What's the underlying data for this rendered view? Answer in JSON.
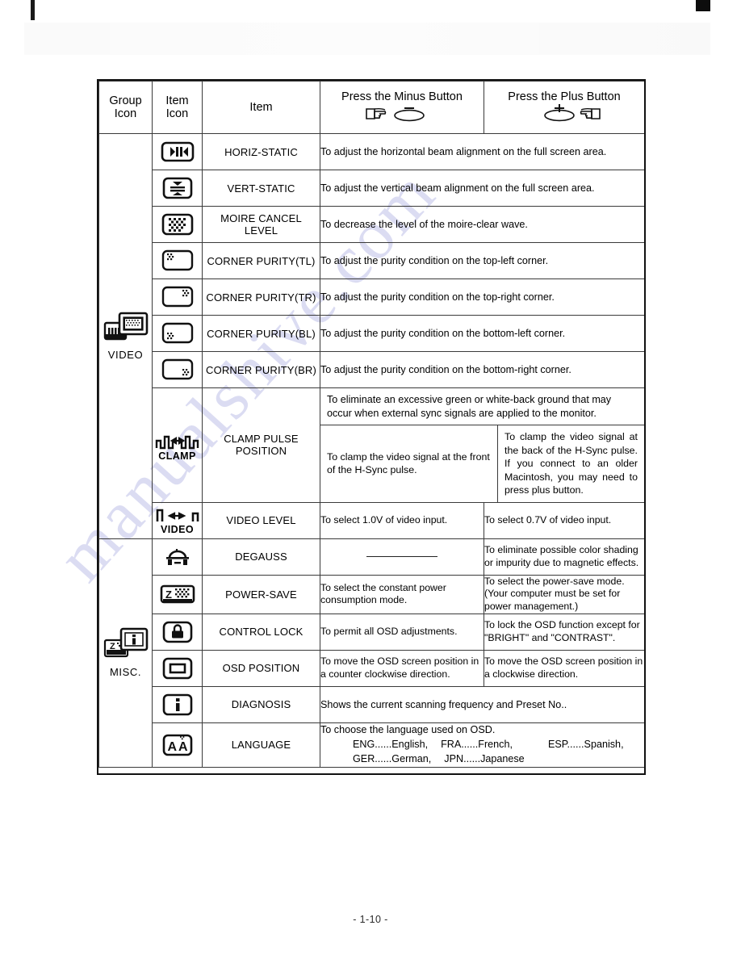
{
  "page": {
    "footer_label": "- 1-10 -",
    "watermark_text": "manualshive.com"
  },
  "table": {
    "headers": {
      "group_icon": "Group\nIcon",
      "group_icon_line1": "Group",
      "group_icon_line2": "Icon",
      "item_icon_line1": "Item",
      "item_icon_line2": "Icon",
      "item": "Item",
      "minus": "Press the Minus Button",
      "plus": "Press the Plus Button",
      "minus_icon": "hand-pointing-right-minus-button-icon",
      "plus_icon": "hand-pointing-left-plus-button-icon"
    },
    "groups": [
      {
        "label": "VIDEO",
        "icon": "video-monitor-group-icon",
        "rows": [
          {
            "icon": "horiz-static-icon",
            "item": "HORIZ-STATIC",
            "merged": true,
            "desc": "To adjust the horizontal beam alignment on the full screen area."
          },
          {
            "icon": "vert-static-icon",
            "item": "VERT-STATIC",
            "merged": true,
            "desc": "To adjust the vertical beam alignment on the full screen area."
          },
          {
            "icon": "moire-cancel-icon",
            "item": "MOIRE CANCEL LEVEL",
            "merged": true,
            "desc": "To decrease the level of the moire-clear wave."
          },
          {
            "icon": "corner-purity-tl-icon",
            "item": "CORNER PURITY(TL)",
            "merged": true,
            "desc": "To adjust the purity condition on the top-left corner."
          },
          {
            "icon": "corner-purity-tr-icon",
            "item": "CORNER PURITY(TR)",
            "merged": true,
            "desc": "To adjust the purity condition on the top-right corner."
          },
          {
            "icon": "corner-purity-bl-icon",
            "item": "CORNER PURITY(BL)",
            "merged": true,
            "desc": "To adjust the purity condition on the bottom-left corner."
          },
          {
            "icon": "corner-purity-br-icon",
            "item": "CORNER PURITY(BR)",
            "merged": true,
            "desc": "To adjust the purity condition on the bottom-right corner."
          },
          {
            "icon": "clamp-pulse-icon",
            "icon_label": "CLAMP",
            "item": "CLAMP PULSE POSITION",
            "merged": false,
            "note": "To eliminate an excessive green or white-back ground that may occur when external sync signals are applied to the monitor.",
            "minus": "To clamp the video signal at the front of the H-Sync pulse.",
            "plus": "To clamp the video signal at the back of the H-Sync pulse.  If you connect to an older Macintosh, you may need to press plus button."
          },
          {
            "icon": "video-level-icon",
            "icon_label": "VIDEO",
            "item": "VIDEO LEVEL",
            "merged": false,
            "minus": "To select 1.0V of video input.",
            "plus": "To select 0.7V of video input."
          }
        ]
      },
      {
        "label": "MISC.",
        "icon": "misc-group-icon",
        "rows": [
          {
            "icon": "degauss-icon",
            "item": "DEGAUSS",
            "merged": false,
            "minus": "",
            "minus_is_dash": true,
            "plus": "To eliminate possible color shading or impurity due to magnetic effects."
          },
          {
            "icon": "power-save-icon",
            "item": "POWER-SAVE",
            "merged": false,
            "minus": "To select the constant power consumption mode.",
            "plus": "To select the power-save mode. (Your computer must be set for power management.)"
          },
          {
            "icon": "control-lock-icon",
            "item": "CONTROL LOCK",
            "merged": false,
            "minus": "To permit all OSD adjustments.",
            "plus": "To lock the OSD function except for \"BRIGHT\" and \"CONTRAST\"."
          },
          {
            "icon": "osd-position-icon",
            "item": "OSD POSITION",
            "merged": false,
            "minus": "To move the OSD screen position in a counter clockwise direction.",
            "plus": "To move the OSD screen position in a clockwise direction."
          },
          {
            "icon": "diagnosis-icon",
            "item": "DIAGNOSIS",
            "merged": true,
            "desc": "Shows the current scanning frequency and Preset No.."
          },
          {
            "icon": "language-icon",
            "item": "LANGUAGE",
            "merged": true,
            "desc_line1": "To choose the language used on OSD.",
            "desc_line2a": "ENG......English,",
            "desc_line2b": "FRA......French,",
            "desc_line2c": "ESP......Spanish,",
            "desc_line3a": "GER......German,",
            "desc_line3b": "JPN......Japanese"
          }
        ]
      }
    ]
  }
}
